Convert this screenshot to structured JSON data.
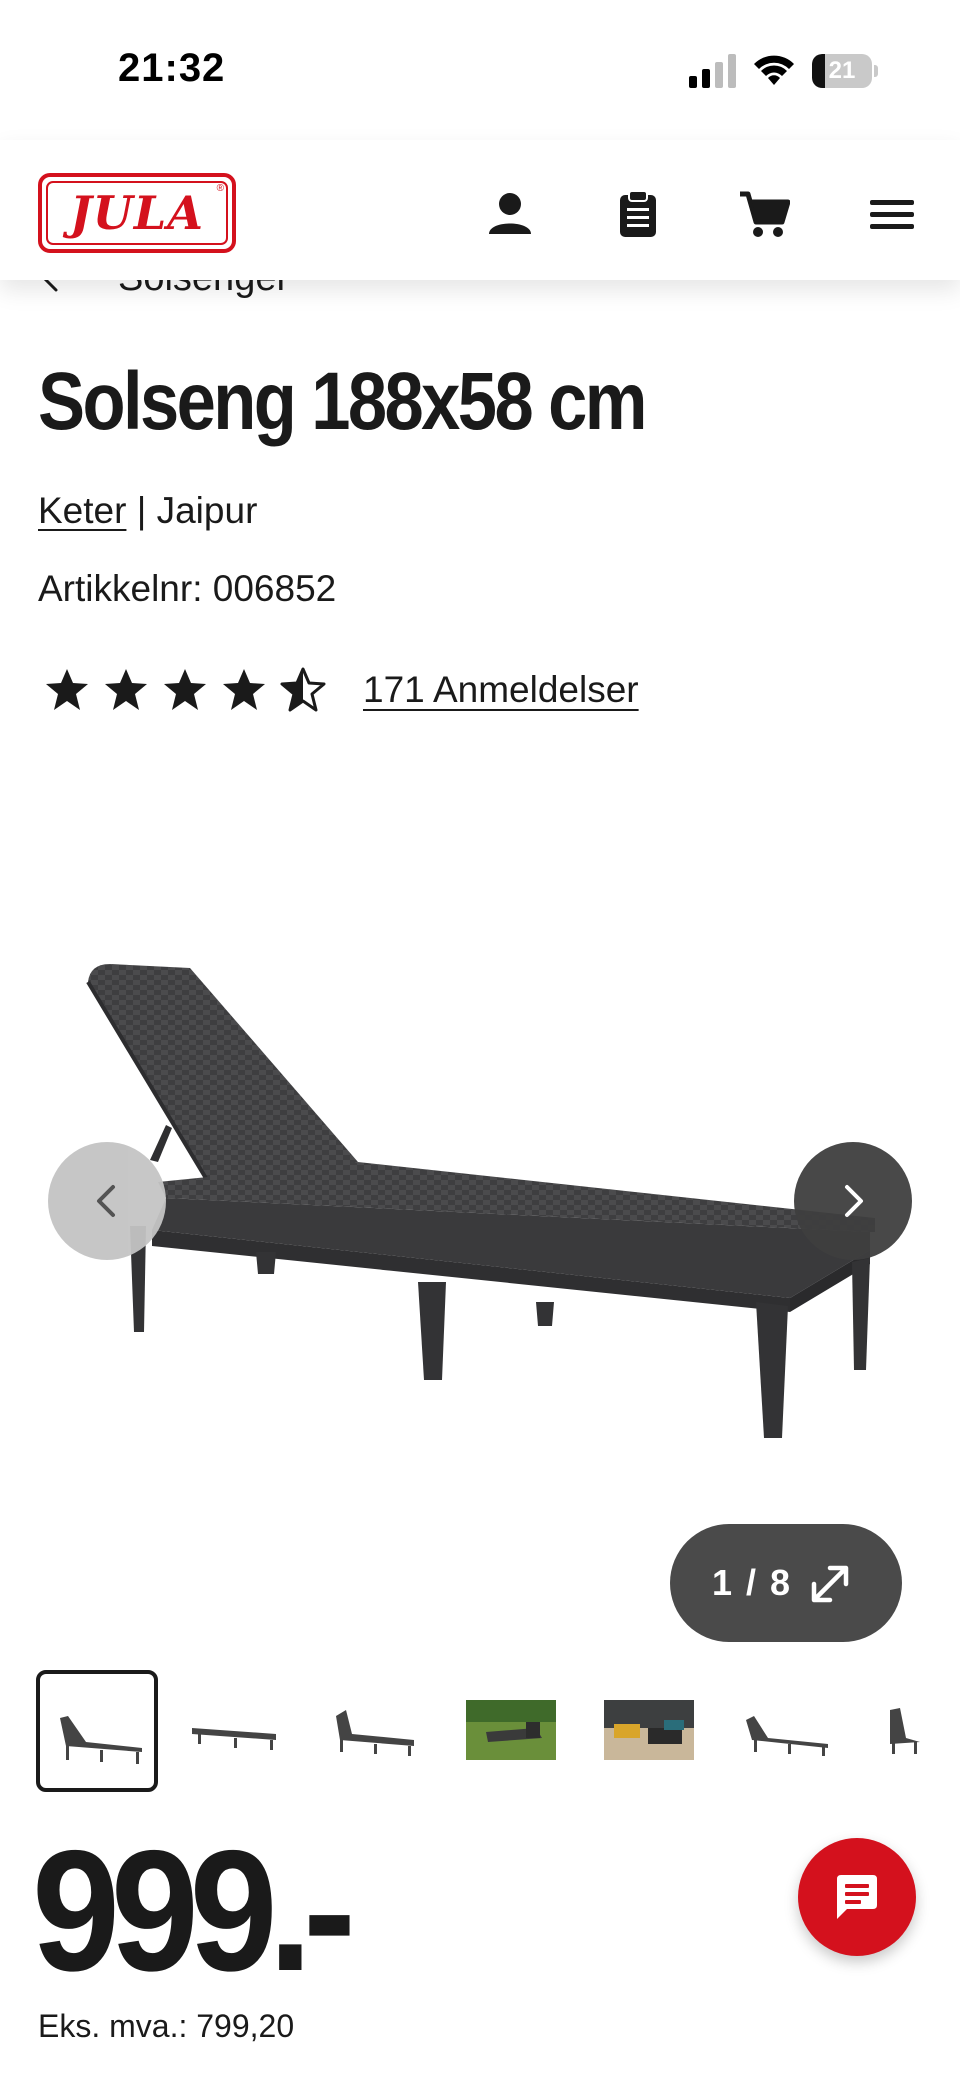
{
  "status_bar": {
    "time": "21:32",
    "battery": "21",
    "battery_level": 0.21
  },
  "header": {
    "logo_text": "JULA",
    "icons": [
      "user-icon",
      "clipboard-icon",
      "cart-icon",
      "menu-icon"
    ]
  },
  "breadcrumb": {
    "label": "Solsenger"
  },
  "product": {
    "title": "Solseng 188x58 cm",
    "brand": "Keter",
    "separator": " | ",
    "series": "Jaipur",
    "sku": "Artikkelnr: 006852",
    "rating": 4.5,
    "reviews_label": "171 Anmeldelser"
  },
  "gallery": {
    "counter": "1 / 8",
    "thumbnails": [
      "lounger-front",
      "lounger-flat",
      "lounger-side",
      "lounger-garden",
      "lounger-patio",
      "lounger-angle",
      "lounger-back"
    ]
  },
  "pricing": {
    "price": "999.-",
    "ex_vat": "Eks. mva.: 799,20"
  },
  "colors": {
    "brand_red": "#d4111d",
    "text": "#1a1a1a",
    "pill": "#4a4a4a"
  }
}
